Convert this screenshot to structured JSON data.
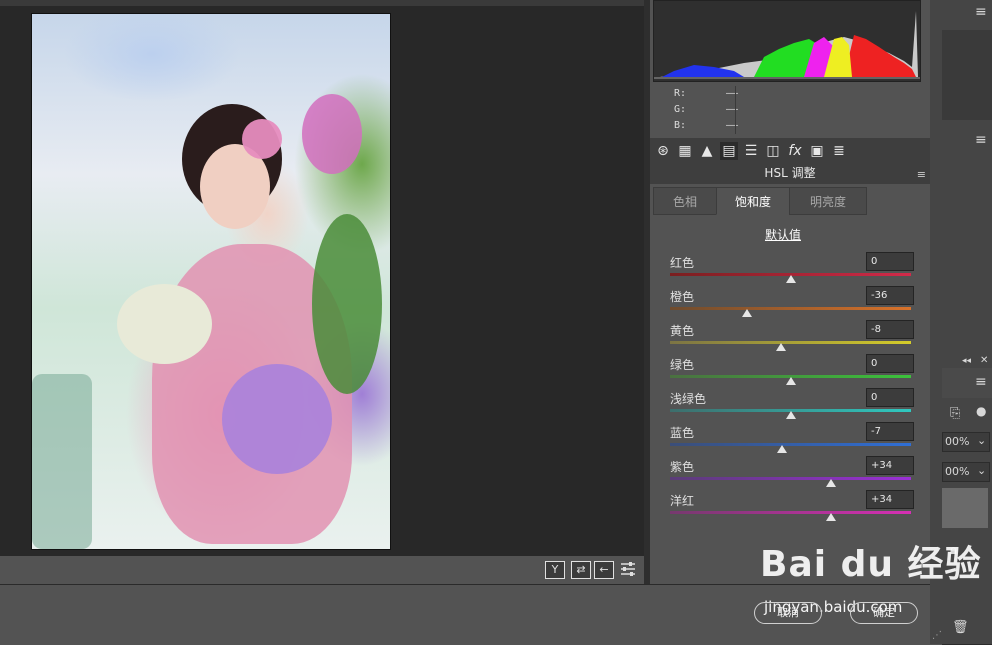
{
  "histogram": {
    "rgb": {
      "r_label": "R:",
      "g_label": "G:",
      "b_label": "B:",
      "r_value": "——",
      "g_value": "——",
      "b_value": "——"
    }
  },
  "panel_icons": [
    "basic-icon",
    "tone-curve-icon",
    "detail-icon",
    "hsl-icon",
    "split-toning-icon",
    "lens-corrections-icon",
    "fx-icon",
    "camera-calibration-icon",
    "presets-icon"
  ],
  "hsl": {
    "title": "HSL 调整",
    "tabs": [
      "色相",
      "饱和度",
      "明亮度"
    ],
    "active_tab": "饱和度",
    "default_label": "默认值",
    "sliders": [
      {
        "label": "红色",
        "value": "0",
        "num": 0,
        "color_from": "#7a1f1f",
        "color_to": "#d22a4a"
      },
      {
        "label": "橙色",
        "value": "-36",
        "num": -36,
        "color_from": "#6e4b2d",
        "color_to": "#d9722a"
      },
      {
        "label": "黄色",
        "value": "-8",
        "num": -8,
        "color_from": "#7c7444",
        "color_to": "#d5cc2a"
      },
      {
        "label": "绿色",
        "value": "0",
        "num": 0,
        "color_from": "#4a7040",
        "color_to": "#3bc33b"
      },
      {
        "label": "浅绿色",
        "value": "0",
        "num": 0,
        "color_from": "#3d6e6c",
        "color_to": "#2fc9c0"
      },
      {
        "label": "蓝色",
        "value": "-7",
        "num": -7,
        "color_from": "#3b4e78",
        "color_to": "#2f6fd6"
      },
      {
        "label": "紫色",
        "value": "+34",
        "num": 34,
        "color_from": "#5a3c78",
        "color_to": "#9b2fd6"
      },
      {
        "label": "洋红",
        "value": "+34",
        "num": 34,
        "color_from": "#76396e",
        "color_to": "#d62fb4"
      }
    ]
  },
  "canvas_toolbar": {
    "buttons": [
      "Y",
      "⇄",
      "←"
    ]
  },
  "right_strip": {
    "zoom_1": "00%",
    "zoom_2": "00%"
  },
  "dialog": {
    "cancel_label": "取消",
    "ok_label": "确定"
  },
  "watermark": {
    "brand": "Bai du 经验",
    "url": "jingyan.baidu.com"
  },
  "colors": {
    "panel_bg": "#535353",
    "dark_bg": "#282828",
    "accent_active": "#ffffff"
  }
}
